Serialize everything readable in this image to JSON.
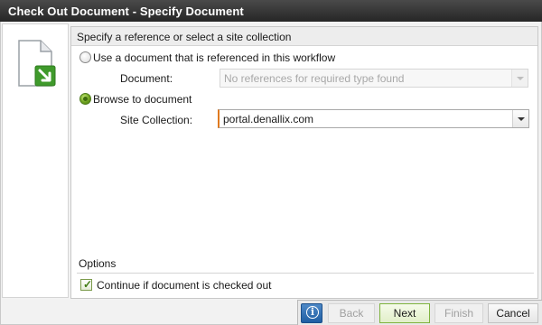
{
  "window": {
    "title": "Check Out Document - Specify Document"
  },
  "section": {
    "header": "Specify a reference or select a site collection"
  },
  "option_reference": {
    "label": "Use a document that is referenced in this workflow",
    "selected": false,
    "document_label": "Document:",
    "document_value": "No references for required type found",
    "document_enabled": false
  },
  "option_browse": {
    "label": "Browse to document",
    "selected": true,
    "site_collection_label": "Site Collection:",
    "site_collection_value": "portal.denallix.com"
  },
  "options": {
    "header": "Options",
    "continue_label": "Continue if document is checked out",
    "continue_checked": true
  },
  "buttons": {
    "info_glyph": "i",
    "back": "Back",
    "next": "Next",
    "finish": "Finish",
    "cancel": "Cancel"
  },
  "icons": {
    "document": "document-with-green-arrow-icon",
    "info": "info-icon",
    "dropdown": "chevron-down-icon",
    "check": "checkmark-icon"
  },
  "colors": {
    "title_bar": "#333333",
    "accent_green": "#6ea11f",
    "focus_orange": "#e07a1f",
    "info_blue": "#2a6bb0"
  }
}
